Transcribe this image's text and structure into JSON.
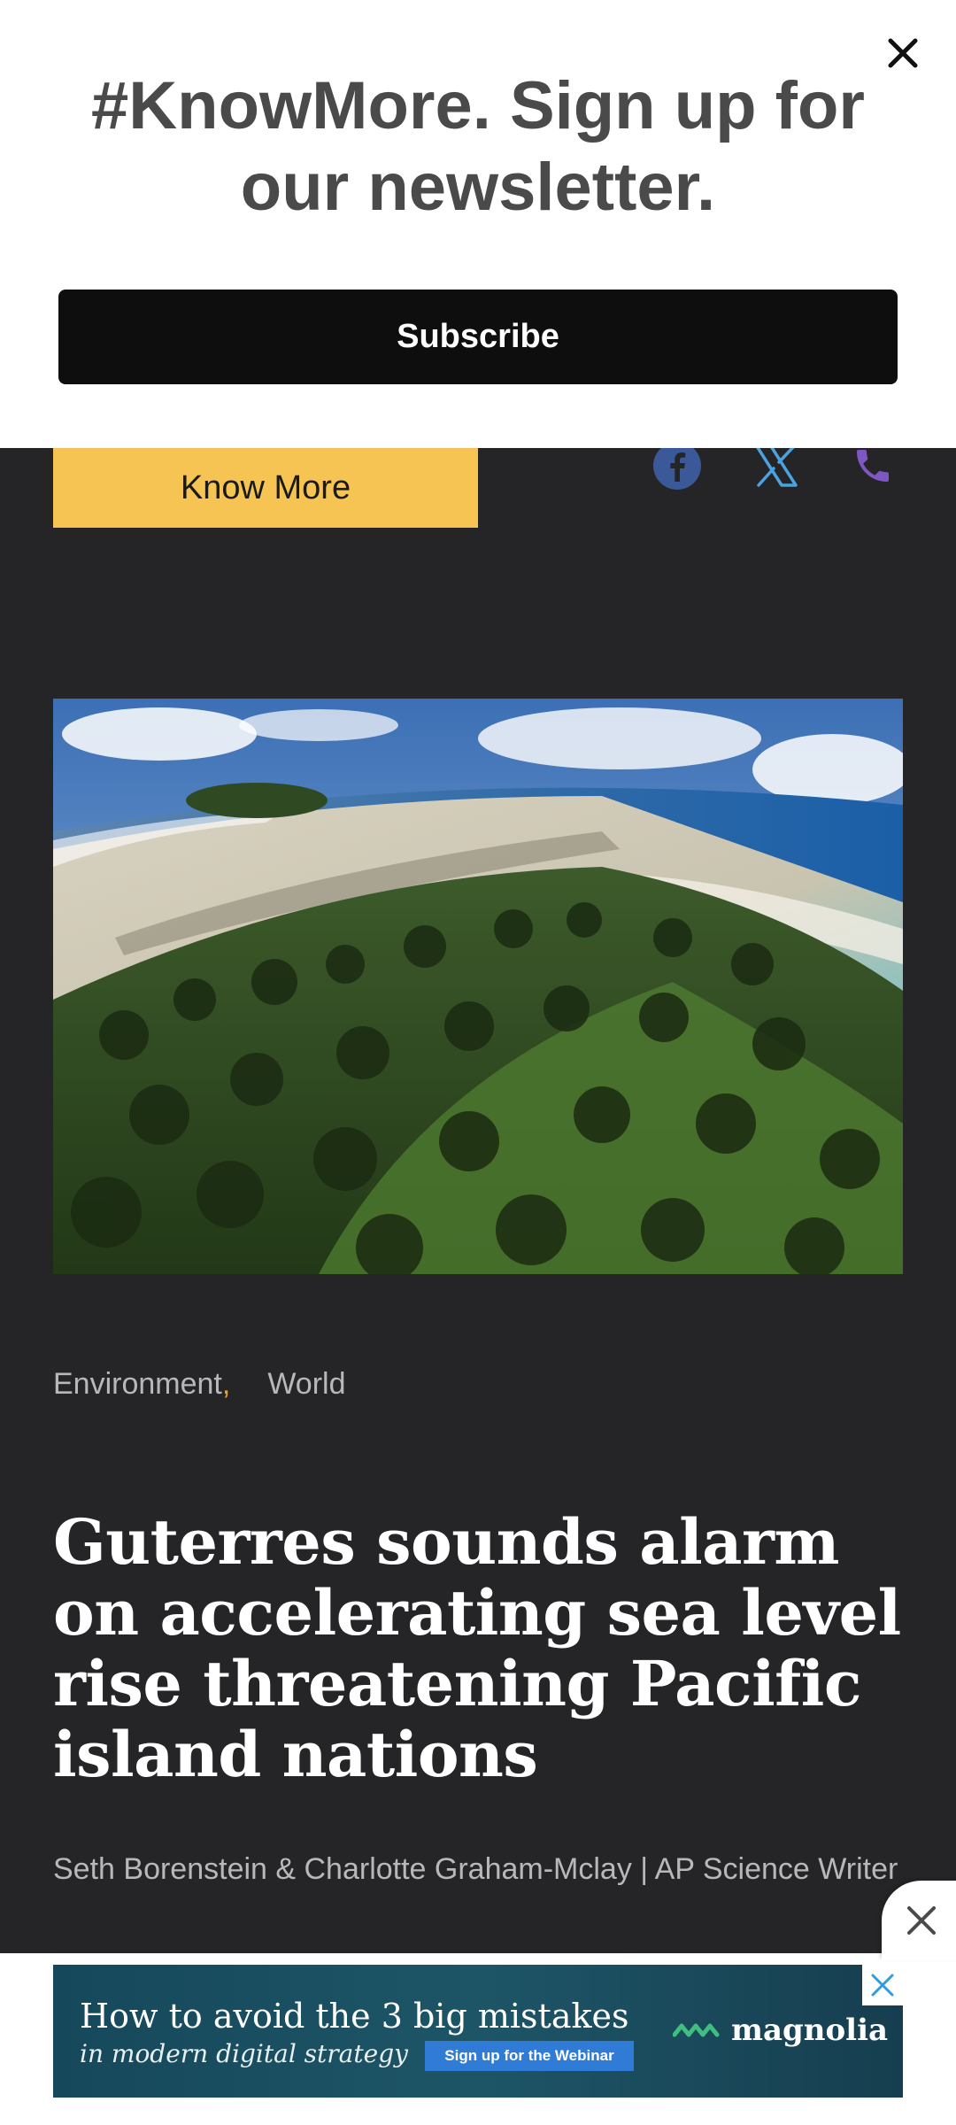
{
  "newsletter": {
    "title": "#KnowMore. Sign up for our newsletter.",
    "subscribe_label": "Subscribe"
  },
  "article": {
    "know_more_label": "Know More",
    "categories": [
      "Environment",
      "World"
    ],
    "category_separator": ",",
    "headline": "Guterres sounds alarm on accelerating sea level rise threatening Pacific island nations",
    "byline": "Seth Borenstein & Charlotte Graham-Mclay | AP Science Writer"
  },
  "social": {
    "facebook_color": "#3b5998",
    "x_color": "#4aa3e0",
    "phone_color": "#7e57c2"
  },
  "ad": {
    "line1": "How to avoid the 3 big mistakes",
    "line2": "in modern digital strategy",
    "cta": "Sign up for the Webinar",
    "brand": "magnolia"
  }
}
